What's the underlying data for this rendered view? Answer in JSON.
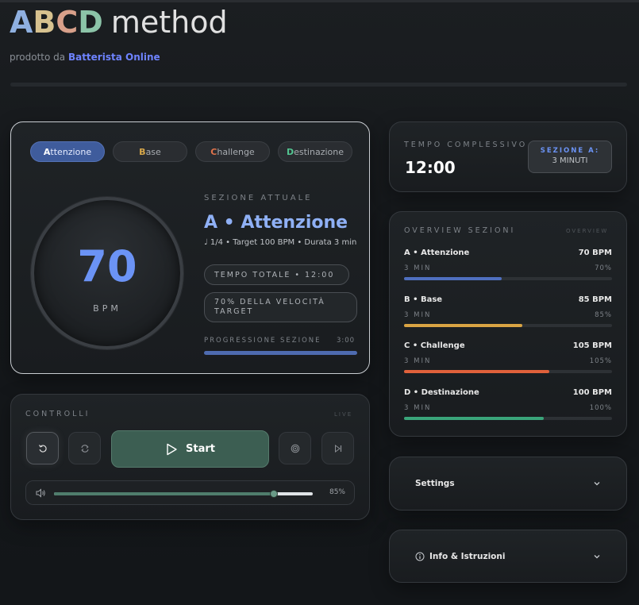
{
  "header": {
    "logo_a": "A",
    "logo_b": "B",
    "logo_c": "C",
    "logo_d": "D",
    "logo_rest": "method",
    "subtitle_prefix": "prodotto da",
    "subtitle_brand": "Batterista Online"
  },
  "tabs": [
    {
      "letter": "A",
      "rest": "ttenzione",
      "active": true
    },
    {
      "letter": "B",
      "rest": "ase",
      "active": false
    },
    {
      "letter": "C",
      "rest": "hallenge",
      "active": false
    },
    {
      "letter": "D",
      "rest": "estinazione",
      "active": false
    }
  ],
  "dial": {
    "value": "70",
    "unit": "BPM"
  },
  "current_section": {
    "label": "SEZIONE ATTUALE",
    "title": "A • Attenzione",
    "meta": "♩ 1/4 • Target 100 BPM • Durata 3 min",
    "total_time_pill": "TEMPO TOTALE • 12:00",
    "speed_pill": "70% DELLA VELOCITÀ TARGET",
    "progress_label": "PROGRESSIONE SEZIONE",
    "progress_time": "3:00",
    "progress_fraction": 1.0
  },
  "controls": {
    "label": "CONTROLLI",
    "live_label": "LIVE",
    "start_label": "Start",
    "volume_pct": "85%",
    "volume_fraction": 0.85
  },
  "total_time": {
    "label": "TEMPO COMPLESSIVO",
    "value": "12:00",
    "badge_label": "SEZIONE A:",
    "badge_value": "3 MINUTI"
  },
  "overview": {
    "label": "OVERVIEW SEZIONI",
    "tiny_label": "OVERVIEW",
    "items": [
      {
        "name": "A • Attenzione",
        "bpm": "70 BPM",
        "duration": "3 MIN",
        "pct": "70%",
        "fraction": 0.47,
        "color": "#4f6fbf"
      },
      {
        "name": "B • Base",
        "bpm": "85 BPM",
        "duration": "3 MIN",
        "pct": "85%",
        "fraction": 0.57,
        "color": "#d9a443"
      },
      {
        "name": "C • Challenge",
        "bpm": "105 BPM",
        "duration": "3 MIN",
        "pct": "105%",
        "fraction": 0.7,
        "color": "#e0613b"
      },
      {
        "name": "D • Destinazione",
        "bpm": "100 BPM",
        "duration": "3 MIN",
        "pct": "100%",
        "fraction": 0.67,
        "color": "#3aa57a"
      }
    ]
  },
  "settings": {
    "label": "Settings"
  },
  "info": {
    "label": "Info & Istruzioni"
  },
  "colors": {
    "accent_blue": "#6b93f5",
    "brand_link": "#6e83ff",
    "start_green": "#3c5e52"
  }
}
